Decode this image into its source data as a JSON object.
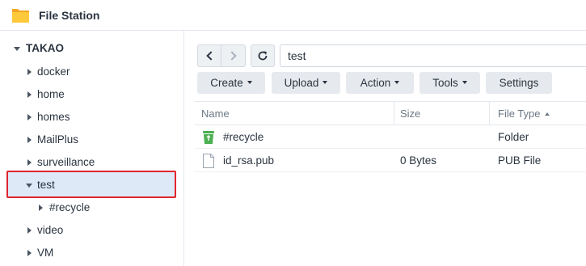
{
  "app": {
    "title": "File Station"
  },
  "sidebar": {
    "root": "TAKAO",
    "items": [
      {
        "label": "docker"
      },
      {
        "label": "home"
      },
      {
        "label": "homes"
      },
      {
        "label": "MailPlus"
      },
      {
        "label": "surveillance"
      },
      {
        "label": "test",
        "expanded": true,
        "selected": true
      },
      {
        "label": "#recycle",
        "child_of": "test"
      },
      {
        "label": "video"
      },
      {
        "label": "VM"
      }
    ]
  },
  "toolbar": {
    "path": "test",
    "back_icon": "chevron-left-icon",
    "forward_icon": "chevron-right-icon",
    "refresh_icon": "refresh-icon",
    "buttons": {
      "create": "Create",
      "upload": "Upload",
      "action": "Action",
      "tools": "Tools",
      "settings": "Settings"
    }
  },
  "grid": {
    "columns": {
      "name": "Name",
      "size": "Size",
      "type": "File Type"
    },
    "sorted_column": "File Type",
    "rows": [
      {
        "name": "#recycle",
        "size": "",
        "type": "Folder",
        "icon": "recycle-bin-icon"
      },
      {
        "name": "id_rsa.pub",
        "size": "0 Bytes",
        "type": "PUB File",
        "icon": "file-icon"
      }
    ]
  },
  "colors": {
    "accent": "#4c8fd6",
    "selection": "#dde9f7",
    "highlight_border": "#e0252e",
    "folder": "#f5b400",
    "recycle": "#4caf50"
  }
}
